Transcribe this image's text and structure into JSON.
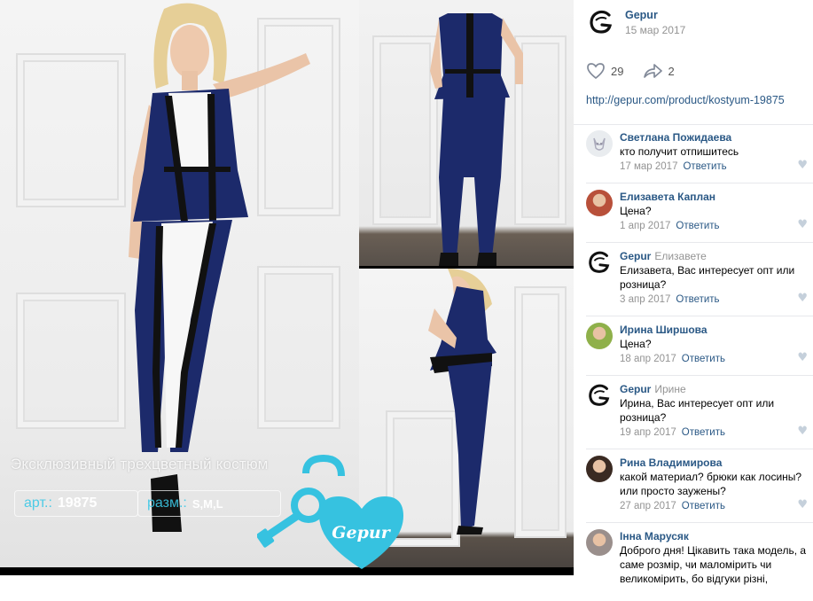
{
  "photo": {
    "caption": "Эксклюзивный трехцветный костюм",
    "art_label": "арт.:",
    "art_value": "19875",
    "size_label": "разм.:",
    "size_value": "S,M,L",
    "logo_text": "Gepur",
    "colors": {
      "navy": "#1c2a6b",
      "white": "#f7f7f7",
      "black": "#111111",
      "accent": "#36c2e0"
    }
  },
  "post": {
    "author": "Gepur",
    "date": "15 мар 2017",
    "likes": "29",
    "shares": "2",
    "link": "http://gepur.com/product/kostyum-19875"
  },
  "comments": [
    {
      "author": "Светлана Пожидаева",
      "reply_to": "",
      "text": "кто получит отпишитесь",
      "date": "17 мар 2017",
      "reply": "Ответить",
      "avatar": "dog-avatar"
    },
    {
      "author": "Елизавета Каплан",
      "reply_to": "",
      "text": "Цена?",
      "date": "1 апр 2017",
      "reply": "Ответить",
      "avatar": "photo-avatar-red"
    },
    {
      "author": "Gepur",
      "reply_to": "Елизавете",
      "text": "Елизавета, Вас интересует опт или розница?",
      "date": "3 апр 2017",
      "reply": "Ответить",
      "avatar": "brand-avatar"
    },
    {
      "author": "Ирина Ширшова",
      "reply_to": "",
      "text": "Цена?",
      "date": "18 апр 2017",
      "reply": "Ответить",
      "avatar": "photo-avatar-green"
    },
    {
      "author": "Gepur",
      "reply_to": "Ирине",
      "text": "Ирина, Вас интересует опт или розница?",
      "date": "19 апр 2017",
      "reply": "Ответить",
      "avatar": "brand-avatar"
    },
    {
      "author": "Рина Владимирова",
      "reply_to": "",
      "text": "какой материал? брюки как лосины? или просто заужены?",
      "date": "27 апр 2017",
      "reply": "Ответить",
      "avatar": "photo-avatar-dark"
    },
    {
      "author": "Інна Марусяк",
      "reply_to": "",
      "text": "Доброго дня! Цікавить така модель, а саме розмір, чи маломірить чи великомірить, бо відгуки різні,",
      "date": "",
      "reply": "",
      "avatar": "photo-avatar-grey"
    }
  ]
}
